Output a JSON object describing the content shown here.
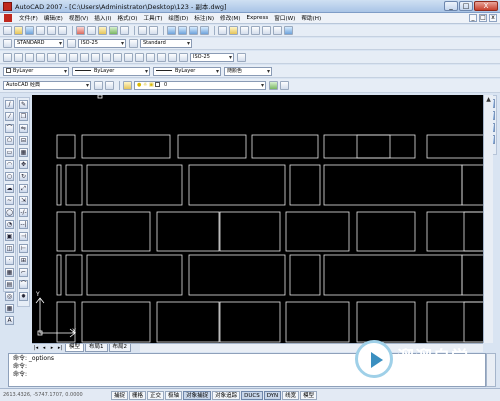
{
  "window": {
    "title": "AutoCAD 2007 - [C:\\Users\\Administrator\\Desktop\\123 - 副本.dwg]",
    "buttons": [
      "_",
      "□",
      "X"
    ]
  },
  "menubar": {
    "items": [
      "文件(F)",
      "编辑(E)",
      "视图(V)",
      "插入(I)",
      "格式(O)",
      "工具(T)",
      "绘图(D)",
      "标注(N)",
      "修改(M)",
      "Express",
      "窗口(W)",
      "帮助(H)"
    ],
    "mdi_buttons": [
      "_",
      "□",
      "x"
    ]
  },
  "styles_toolbar": {
    "text_style": "STANDARD",
    "dim_style": "ISO-25",
    "table_style": "Standard"
  },
  "dim_toolbar": {
    "dim_style": "ISO-25"
  },
  "properties_toolbar": {
    "color": "ByLayer",
    "linetype": "ByLayer",
    "lineweight": "ByLayer",
    "plotstyle": "随颜色"
  },
  "workspace_toolbar": {
    "workspace": "AutoCAD 经典",
    "layer": "0"
  },
  "left_toolbar_icons": [
    "line-icon",
    "xline-icon",
    "polyline-icon",
    "polygon-icon",
    "rectangle-icon",
    "arc-icon",
    "circle-icon",
    "revcloud-icon",
    "spline-icon",
    "ellipse-icon",
    "ellipse-arc-icon",
    "insert-block-icon",
    "make-block-icon",
    "point-icon",
    "hatch-icon",
    "gradient-icon",
    "region-icon",
    "table-icon",
    "mtext-icon"
  ],
  "left_toolbar_glyphs": [
    "/",
    "⁄",
    "⌒",
    "⬠",
    "▭",
    "◠",
    "○",
    "☁",
    "~",
    "◯",
    "◔",
    "▣",
    "◫",
    "·",
    "▦",
    "▤",
    "◎",
    "▦",
    "A"
  ],
  "modify_toolbar_icons": [
    "erase-icon",
    "copy-icon",
    "mirror-icon",
    "offset-icon",
    "array-icon",
    "move-icon",
    "rotate-icon",
    "scale-icon",
    "stretch-icon",
    "trim-icon",
    "extend-icon",
    "break-at-point-icon",
    "break-icon",
    "join-icon",
    "chamfer-icon",
    "fillet-icon",
    "explode-icon"
  ],
  "modify_toolbar_glyphs": [
    "✎",
    "❐",
    "⇋",
    "⊟",
    "▦",
    "✥",
    "↻",
    "⤢",
    "⇲",
    "-/-",
    "--|",
    "⊣",
    "⊢",
    "⊞",
    "⌐",
    "⌒",
    "✸"
  ],
  "ucs": {
    "x_label": "X",
    "y_label": "Y"
  },
  "layout_tabs": [
    "模型",
    "布局1",
    "布局2"
  ],
  "layout_nav": [
    "|◂",
    "◂",
    "▸",
    "▸|"
  ],
  "command_line": {
    "lines": [
      "命令:  _options",
      "命令:",
      "命令:"
    ]
  },
  "status_bar": {
    "coords": "2613.4326, -5747.1707, 0.0000",
    "buttons": [
      "捕捉",
      "栅格",
      "正交",
      "极轴",
      "对象捕捉",
      "对象追踪",
      "DUCS",
      "DYN",
      "线宽",
      "模型"
    ],
    "active": [
      "对象捕捉",
      "DUCS",
      "DYN"
    ]
  },
  "watermark": {
    "title": "溜溜自学",
    "url": "ZIXUE.3D66.COM"
  },
  "drawing": {
    "stroke_color": "#e8e8e8",
    "background": "#000000"
  }
}
